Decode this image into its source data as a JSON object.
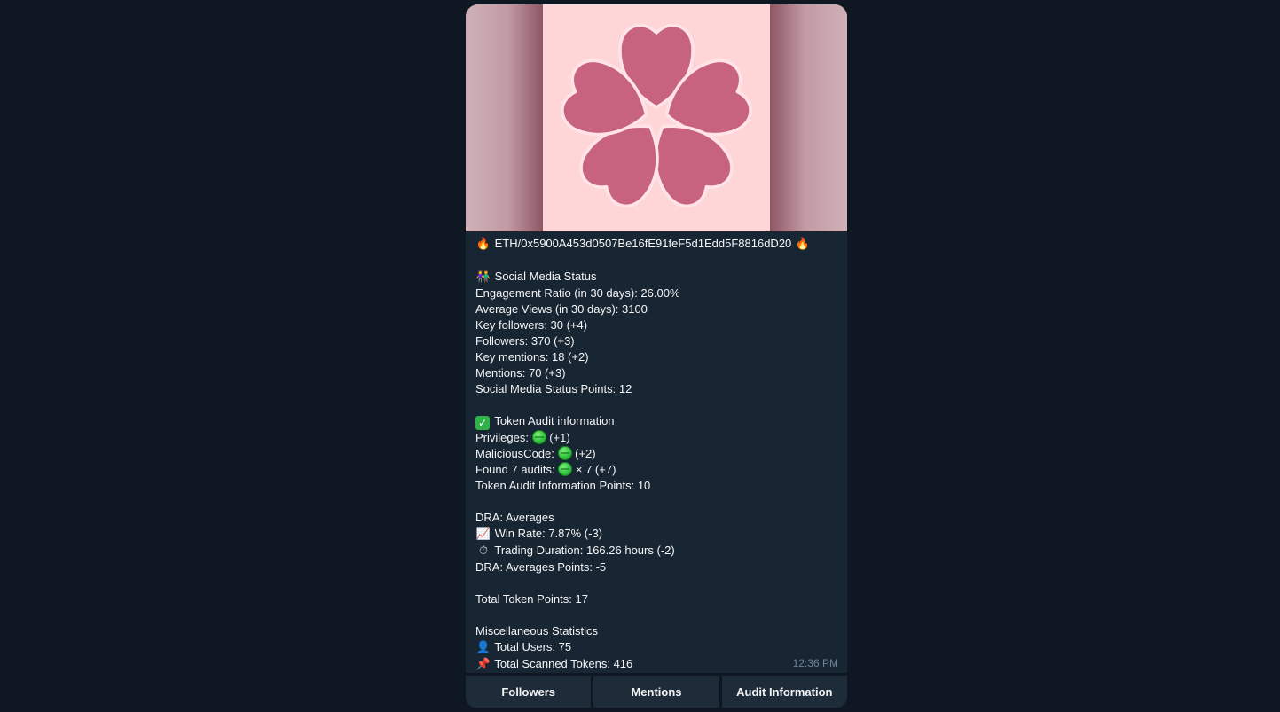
{
  "message": {
    "header": {
      "icon_left": "fire-icon",
      "text": "ETH/0x5900A453d0507Be16fE91feF5d1Edd5F8816dD20",
      "icon_right": "fire-icon"
    },
    "social": {
      "title_icon": "people-icon",
      "title": "Social Media Status",
      "lines": [
        "Engagement Ratio (in 30 days): 26.00%",
        "Average Views (in 30 days): 3100",
        "Key followers: 30 (+4)",
        "Followers: 370 (+3)",
        "Key mentions: 18 (+2)",
        "Mentions: 70 (+3)",
        "Social Media Status Points: 12"
      ]
    },
    "audit": {
      "title_icon": "check-mark-icon",
      "title": "Token Audit information",
      "privileges_label": "Privileges:",
      "privileges_suffix": "(+1)",
      "malicious_label": "MaliciousCode:",
      "malicious_suffix": "(+2)",
      "found_label": "Found 7 audits:",
      "found_suffix": "× 7 (+7)",
      "points": "Token Audit Information Points: 10"
    },
    "dra": {
      "title": "DRA: Averages",
      "win_rate_icon": "chart-increasing-icon",
      "win_rate": "Win Rate: 7.87% (-3)",
      "duration_icon": "stopwatch-icon",
      "duration": "Trading Duration: 166.26 hours (-2)",
      "points": "DRA: Averages Points: -5"
    },
    "total": "Total Token Points: 17",
    "misc": {
      "title": "Miscellaneous Statistics",
      "users_icon": "user-icon",
      "users": "Total Users: 75",
      "tokens_icon": "pushpin-icon",
      "tokens": "Total Scanned Tokens: 416"
    },
    "timestamp": "12:36 PM"
  },
  "keyboard": {
    "followers_label": "Followers",
    "mentions_label": "Mentions",
    "audit_label": "Audit Information"
  },
  "colors": {
    "background": "#0f1722",
    "bubble": "#182533",
    "button": "#1e2c3a",
    "flower": "#c7637f",
    "photo_bg": "#ffd6d8"
  }
}
